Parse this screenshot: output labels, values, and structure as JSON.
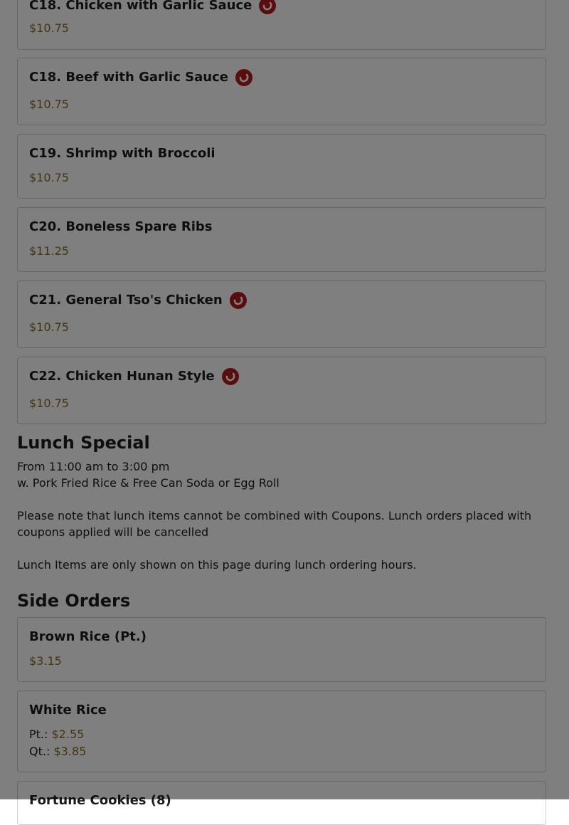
{
  "menu_items": [
    {
      "name": "C18. Chicken with Garlic Sauce",
      "price": "$10.75",
      "spicy": true
    },
    {
      "name": "C18. Beef with Garlic Sauce",
      "price": "$10.75",
      "spicy": true
    },
    {
      "name": "C19. Shrimp with Broccoli",
      "price": "$10.75",
      "spicy": false
    },
    {
      "name": "C20. Boneless Spare Ribs",
      "price": "$11.25",
      "spicy": false
    },
    {
      "name": "C21. General Tso's Chicken",
      "price": "$10.75",
      "spicy": true
    },
    {
      "name": "C22. Chicken Hunan Style",
      "price": "$10.75",
      "spicy": true
    }
  ],
  "lunch_special": {
    "title": "Lunch Special",
    "hours": "From 11:00 am to 3:00 pm",
    "includes": "w. Pork Fried Rice & Free Can Soda or Egg Roll",
    "coupon_note": "Please note that lunch items cannot be combined with Coupons. Lunch orders placed with coupons applied will be cancelled",
    "hours_note": "Lunch Items are only shown on this page during lunch ordering hours."
  },
  "side_orders": {
    "title": "Side Orders",
    "items": [
      {
        "name": "Brown Rice (Pt.)",
        "price": "$3.15"
      },
      {
        "name": "White Rice",
        "sizes": [
          {
            "label": "Pt.:",
            "price": "$2.55"
          },
          {
            "label": "Qt.:",
            "price": "$3.85"
          }
        ]
      },
      {
        "name": "Fortune Cookies (8)"
      }
    ]
  },
  "icons": {
    "spicy": "chili-pepper-icon"
  },
  "colors": {
    "price": "#8a6a1c",
    "spicy_badge": "#b11c1c",
    "overlay": "rgba(0,0,0,0.5)"
  }
}
